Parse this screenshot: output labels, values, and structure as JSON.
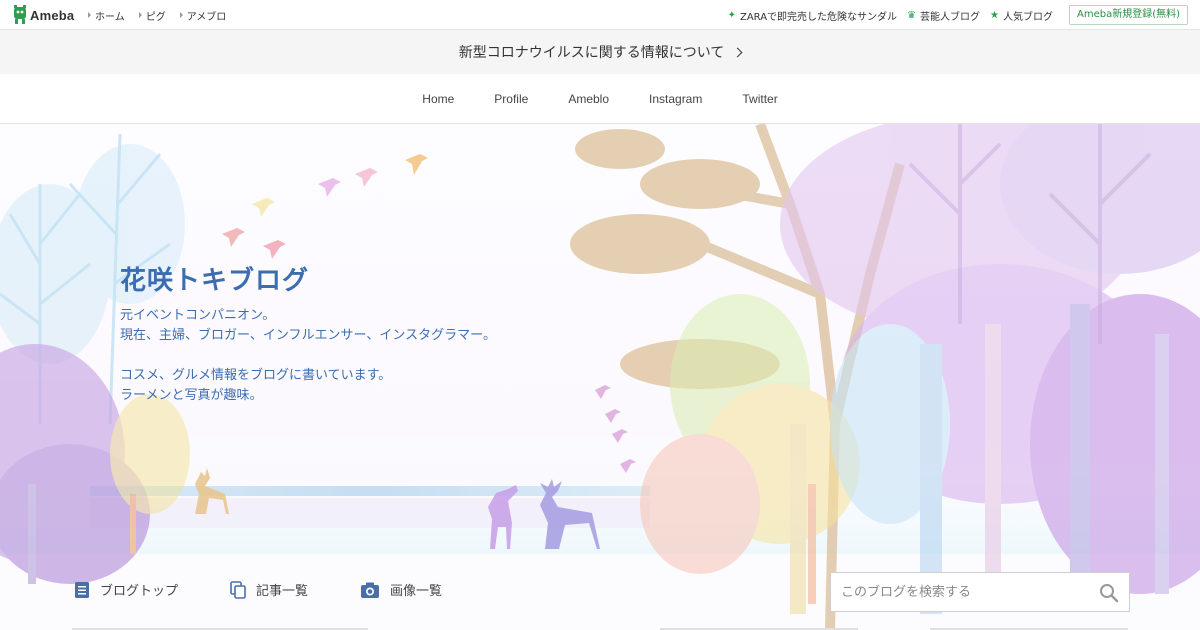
{
  "global_header": {
    "logo_text": "Ameba",
    "nav": [
      {
        "label": "ホーム"
      },
      {
        "label": "ピグ"
      },
      {
        "label": "アメブロ"
      }
    ],
    "right_links": [
      {
        "icon": "sparkle-icon",
        "label": "ZARAで即完売した危険なサンダル"
      },
      {
        "icon": "crown-icon",
        "label": "芸能人ブログ"
      },
      {
        "icon": "star-icon",
        "label": "人気ブログ"
      }
    ],
    "register_label": "Ameba新規登録(無料)"
  },
  "notice": {
    "text": "新型コロナウイルスに関する情報について"
  },
  "blog_nav": {
    "items": [
      {
        "label": "Home"
      },
      {
        "label": "Profile"
      },
      {
        "label": "Ameblo"
      },
      {
        "label": "Instagram"
      },
      {
        "label": "Twitter"
      }
    ]
  },
  "hero": {
    "title": "花咲トキブログ",
    "description_lines": [
      "元イベントコンパニオン。",
      "現在、主婦、ブロガー、インフルエンサー、インスタグラマー。",
      "",
      "コスメ、グルメ情報をブログに書いています。",
      "ラーメンと写真が趣味。"
    ]
  },
  "blog_menu": {
    "items": [
      {
        "icon": "document-icon",
        "label": "ブログトップ"
      },
      {
        "icon": "copy-icon",
        "label": "記事一覧"
      },
      {
        "icon": "camera-icon",
        "label": "画像一覧"
      }
    ],
    "search_placeholder": "このブログを検索する"
  },
  "colors": {
    "accent_blue": "#3c6db0",
    "ameba_green": "#2e9e4f"
  }
}
